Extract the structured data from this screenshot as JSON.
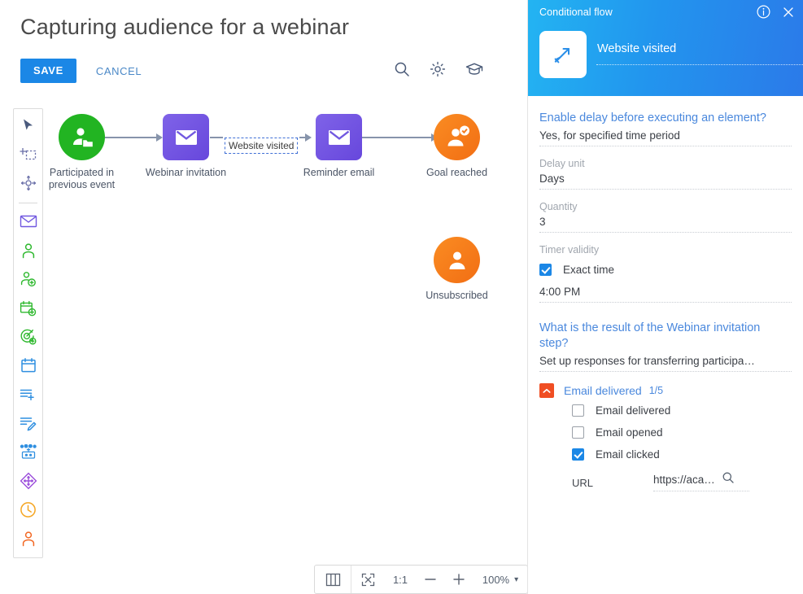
{
  "header": {
    "title": "Capturing audience for a webinar",
    "save_label": "SAVE",
    "cancel_label": "CANCEL",
    "icons": [
      "search-icon",
      "gear-icon",
      "graduation-cap-icon"
    ]
  },
  "toolbar": {
    "items": [
      {
        "name": "pointer-tool",
        "color": "#4a5a7d"
      },
      {
        "name": "marquee-select-tool",
        "color": "#6a6fa8"
      },
      {
        "name": "pan-tool",
        "color": "#6a6fa8"
      },
      {
        "name": "email-element",
        "color": "#7158e0"
      },
      {
        "name": "contact-element",
        "color": "#2eb82e"
      },
      {
        "name": "contact-add-element",
        "color": "#2eb82e"
      },
      {
        "name": "event-calendar-element",
        "color": "#2eb82e"
      },
      {
        "name": "goal-target-element",
        "color": "#2eb82e"
      },
      {
        "name": "calendar-element",
        "color": "#2f8fe0"
      },
      {
        "name": "add-to-list-element",
        "color": "#2f8fe0"
      },
      {
        "name": "edit-record-element",
        "color": "#2f8fe0"
      },
      {
        "name": "ab-test-element",
        "color": "#2f8fe0"
      },
      {
        "name": "conditional-flow-element",
        "color": "#9b4ddb"
      },
      {
        "name": "timer-element",
        "color": "#f5a623"
      },
      {
        "name": "audience-element",
        "color": "#f26722"
      }
    ]
  },
  "flow": {
    "nodes": [
      {
        "id": "participated",
        "label": "Participated in\nprevious event",
        "type": "audience-source",
        "shape": "circle",
        "color": "#22b422",
        "icon": "person-folder-icon"
      },
      {
        "id": "webinar-invitation",
        "label": "Webinar invitation",
        "type": "email",
        "shape": "rounded-square",
        "color": "#7158e0",
        "icon": "envelope-icon"
      },
      {
        "id": "reminder-email",
        "label": "Reminder email",
        "type": "email",
        "shape": "rounded-square",
        "color": "#7158e0",
        "icon": "envelope-icon"
      },
      {
        "id": "goal-reached",
        "label": "Goal reached",
        "type": "goal",
        "shape": "circle",
        "color": "#f57c1f",
        "icon": "person-check-icon"
      },
      {
        "id": "unsubscribed",
        "label": "Unsubscribed",
        "type": "audience",
        "shape": "circle",
        "color": "#f57c1f",
        "icon": "person-icon"
      }
    ],
    "edge_label": "Website visited",
    "edge_color": "#8794ab"
  },
  "zoombar": {
    "layout_label": "columns-icon",
    "fit_label": "fit-screen-icon",
    "ratio_label": "1:1",
    "zoom_out_label": "−",
    "zoom_in_label": "+",
    "zoom_value": "100%",
    "caret": "▾"
  },
  "panel": {
    "kind_label": "Conditional flow",
    "info_icon": "info-icon",
    "close_icon": "close-icon",
    "node_icon": "diagonal-arrow-icon",
    "node_name": "Website visited",
    "delay_question": "Enable delay before executing an element?",
    "delay_value": "Yes, for specified time period",
    "delay_unit_label": "Delay unit",
    "delay_unit_value": "Days",
    "quantity_label": "Quantity",
    "quantity_value": "3",
    "timer_validity_label": "Timer validity",
    "exact_time_label": "Exact time",
    "exact_time_checked": true,
    "time_value": "4:00 PM",
    "result_question": "What is the result of the Webinar invitation step?",
    "responses_value": "Set up responses for transferring participa…",
    "group": {
      "title": "Email delivered",
      "count": "1/5",
      "expanded": true,
      "options": [
        {
          "label": "Email delivered",
          "checked": false
        },
        {
          "label": "Email opened",
          "checked": false
        },
        {
          "label": "Email clicked",
          "checked": true
        }
      ],
      "url_label": "URL",
      "url_value": "https://aca…",
      "url_search_icon": "search-icon"
    }
  },
  "colors": {
    "accent_blue": "#1b87e6",
    "link_blue": "#4a88dd",
    "orange": "#f04e23",
    "purple": "#7158e0",
    "green": "#22b422"
  }
}
